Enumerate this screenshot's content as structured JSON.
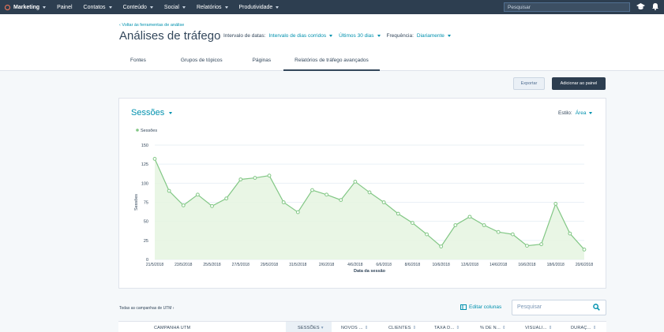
{
  "topnav": {
    "brand": "Marketing",
    "items": [
      "Painel",
      "Contatos",
      "Conteúdo",
      "Social",
      "Relatórios",
      "Produtividade"
    ],
    "search_placeholder": "Pesquisar",
    "icons": [
      "academy-icon",
      "notification-bell-icon"
    ]
  },
  "header": {
    "back_link": "Voltar às ferramentas de análise",
    "title": "Análises de tráfego",
    "date_range_label": "Intervalo de datas:",
    "date_range_type": "Intervalo de dias corridos",
    "date_range_value": "Últimos 30 dias",
    "frequency_label": "Frequência:",
    "frequency_value": "Diariamente",
    "tabs": [
      "Fontes",
      "Grupos de tópicos",
      "Páginas",
      "Relatórios de tráfego avançados"
    ],
    "active_tab": 3
  },
  "actions": {
    "export_label": "Exportar",
    "add_label": "Adicionar ao painel"
  },
  "card": {
    "title": "Sessões",
    "style_label": "Estilo:",
    "style_value": "Área"
  },
  "chart_data": {
    "type": "area",
    "series": [
      {
        "name": "Sessões",
        "values": [
          132,
          90,
          71,
          85,
          70,
          80,
          105,
          107,
          110,
          75,
          62,
          91,
          85,
          78,
          102,
          88,
          75,
          60,
          48,
          33,
          17,
          45,
          56,
          45,
          36,
          33,
          18,
          20,
          73,
          34,
          13
        ]
      }
    ],
    "x": [
      "21/5/2018",
      "22/5/2018",
      "23/5/2018",
      "24/5/2018",
      "25/5/2018",
      "26/5/2018",
      "27/5/2018",
      "28/5/2018",
      "29/5/2018",
      "30/5/2018",
      "31/5/2018",
      "1/6/2018",
      "2/6/2018",
      "3/6/2018",
      "4/6/2018",
      "5/6/2018",
      "6/6/2018",
      "7/6/2018",
      "8/6/2018",
      "9/6/2018",
      "10/6/2018",
      "11/6/2018",
      "12/6/2018",
      "13/6/2018",
      "14/6/2018",
      "15/6/2018",
      "16/6/2018",
      "17/6/2018",
      "18/6/2018",
      "19/6/2018",
      "20/6/2018"
    ],
    "tick_labels": [
      "21/5/2018",
      "23/5/2018",
      "25/5/2018",
      "27/5/2018",
      "29/5/2018",
      "31/5/2018",
      "2/6/2018",
      "4/6/2018",
      "6/6/2018",
      "8/6/2018",
      "10/6/2018",
      "12/6/2018",
      "14/6/2018",
      "16/6/2018",
      "18/6/2018",
      "20/6/2018"
    ],
    "y_ticks": [
      0,
      25,
      50,
      75,
      100,
      125,
      150
    ],
    "ylim": [
      0,
      150
    ],
    "xlabel": "Data da sessão",
    "ylabel": "Sessões",
    "grid": true,
    "legend": "top-left",
    "colors": {
      "line": "#82c785",
      "fill": "#e5f5e0"
    }
  },
  "bottom": {
    "utm_link": "Todas as campanhas de UTM",
    "edit_columns": "Editar colunas",
    "search_placeholder": "Pesquisar",
    "columns": [
      "CAMPANHA UTM",
      "SESSÕES",
      "NOVOS ...",
      "CLIENTES",
      "TAXA D...",
      "% DE N...",
      "VISUALI...",
      "DURAÇ..."
    ]
  }
}
